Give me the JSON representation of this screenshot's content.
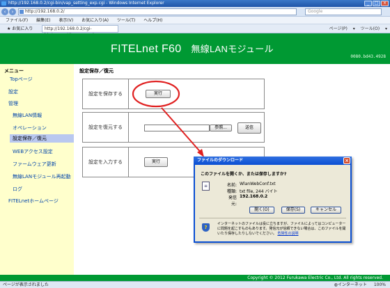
{
  "browser": {
    "title": "http://192.168.0.2/cgi-bin/vap_setting_exp.cgi - Windows Internet Explorer",
    "address": "http://192.168.0.2/",
    "search_placeholder": "Google",
    "menu": [
      "ファイル(F)",
      "編集(E)",
      "表示(V)",
      "お気に入り(A)",
      "ツール(T)",
      "ヘルプ(H)"
    ],
    "favorites_label": "お気に入り",
    "tab_url": "http://192.168.0.2/cgi-bin/vap_setting_exp.cgi",
    "tools": "ページ(P) ▾ ツール(O) ▾",
    "status_left": "ページが表示されました",
    "status_zone": "インターネット",
    "zoom": "100%"
  },
  "header": {
    "product": "FITELnet F60",
    "module": "無線LANモジュール",
    "mac": "0080.bd43.4928"
  },
  "sidebar": {
    "menu_title": "メニュー",
    "items": [
      {
        "label": "Topページ"
      },
      {
        "label": "設定"
      },
      {
        "label": "管理"
      },
      {
        "label": "無線LAN情報"
      },
      {
        "label": "オペレーション"
      },
      {
        "label": "設定保存／復元"
      },
      {
        "label": "WEBアクセス設定"
      },
      {
        "label": "ファームウェア更新"
      },
      {
        "label": "無線LANモジュール再起動"
      },
      {
        "label": "ログ"
      },
      {
        "label": "FITELnetホームページ"
      }
    ]
  },
  "content": {
    "title": "設定保存／復元",
    "rows": [
      {
        "label": "設定を保存する",
        "button": "実行"
      },
      {
        "label": "設定を復元する",
        "browse": "参照...",
        "button": "送信"
      },
      {
        "label": "設定を入力する",
        "button": "実行"
      }
    ]
  },
  "dialog": {
    "title": "ファイルのダウンロード",
    "question": "このファイルを開くか、または保存しますか?",
    "name_label": "名前:",
    "name_value": "WlanWebConf.txt",
    "type_label": "種類:",
    "type_value": "txt file, 244 バイト",
    "from_label": "発信元:",
    "from_value": "192.168.0.2",
    "open_button": "開く(O)",
    "save_button": "保存(S)",
    "cancel_button": "キャンセル",
    "warning": "インターネットのファイルは役に立ちますが、ファイルによってはコンピューターに問題を起こすものもあります。発信元が信頼できない場合は、このファイルを開いたり保存したりしないでください。",
    "risk_link": "危険性の説明"
  },
  "footer": {
    "copyright": "Copyright © 2012 Furukawa Electric Co., Ltd. All rights reserved."
  },
  "colors": {
    "header_green": "#009933",
    "page_yellow": "#ffffcc",
    "highlight_red": "#e02020"
  }
}
